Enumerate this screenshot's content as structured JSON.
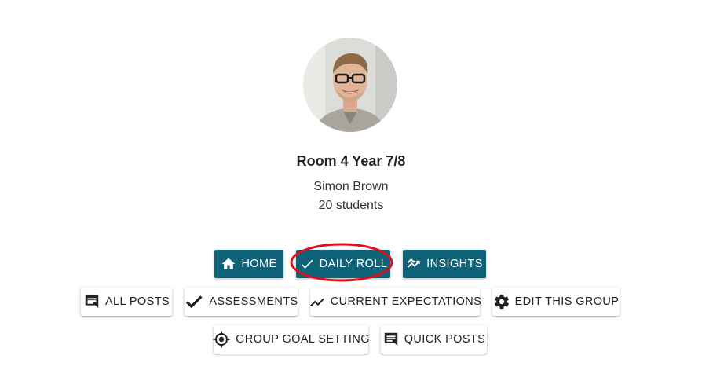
{
  "group": {
    "title": "Room 4 Year 7/8",
    "owner": "Simon Brown",
    "student_count": "20 students"
  },
  "primary_buttons": {
    "home": "HOME",
    "daily_roll": "DAILY ROLL",
    "insights": "INSIGHTS"
  },
  "secondary_buttons": {
    "all_posts": "ALL POSTS",
    "assessments": "ASSESSMENTS",
    "current_expectations": "CURRENT EXPECTATIONS",
    "edit_group": "EDIT THIS GROUP",
    "group_goal_setting": "GROUP GOAL SETTING",
    "quick_posts": "QUICK POSTS"
  },
  "icons": {
    "home": "home-icon",
    "daily_roll": "checkmark-icon",
    "insights": "insights-icon",
    "all_posts": "comment-icon",
    "assessments": "checkmark-icon",
    "current_expectations": "trending-up-icon",
    "edit_group": "gear-icon",
    "group_goal_setting": "target-icon",
    "quick_posts": "comment-icon"
  },
  "colors": {
    "primary_button": "#0e6379",
    "highlight_ring": "#e0101a"
  }
}
